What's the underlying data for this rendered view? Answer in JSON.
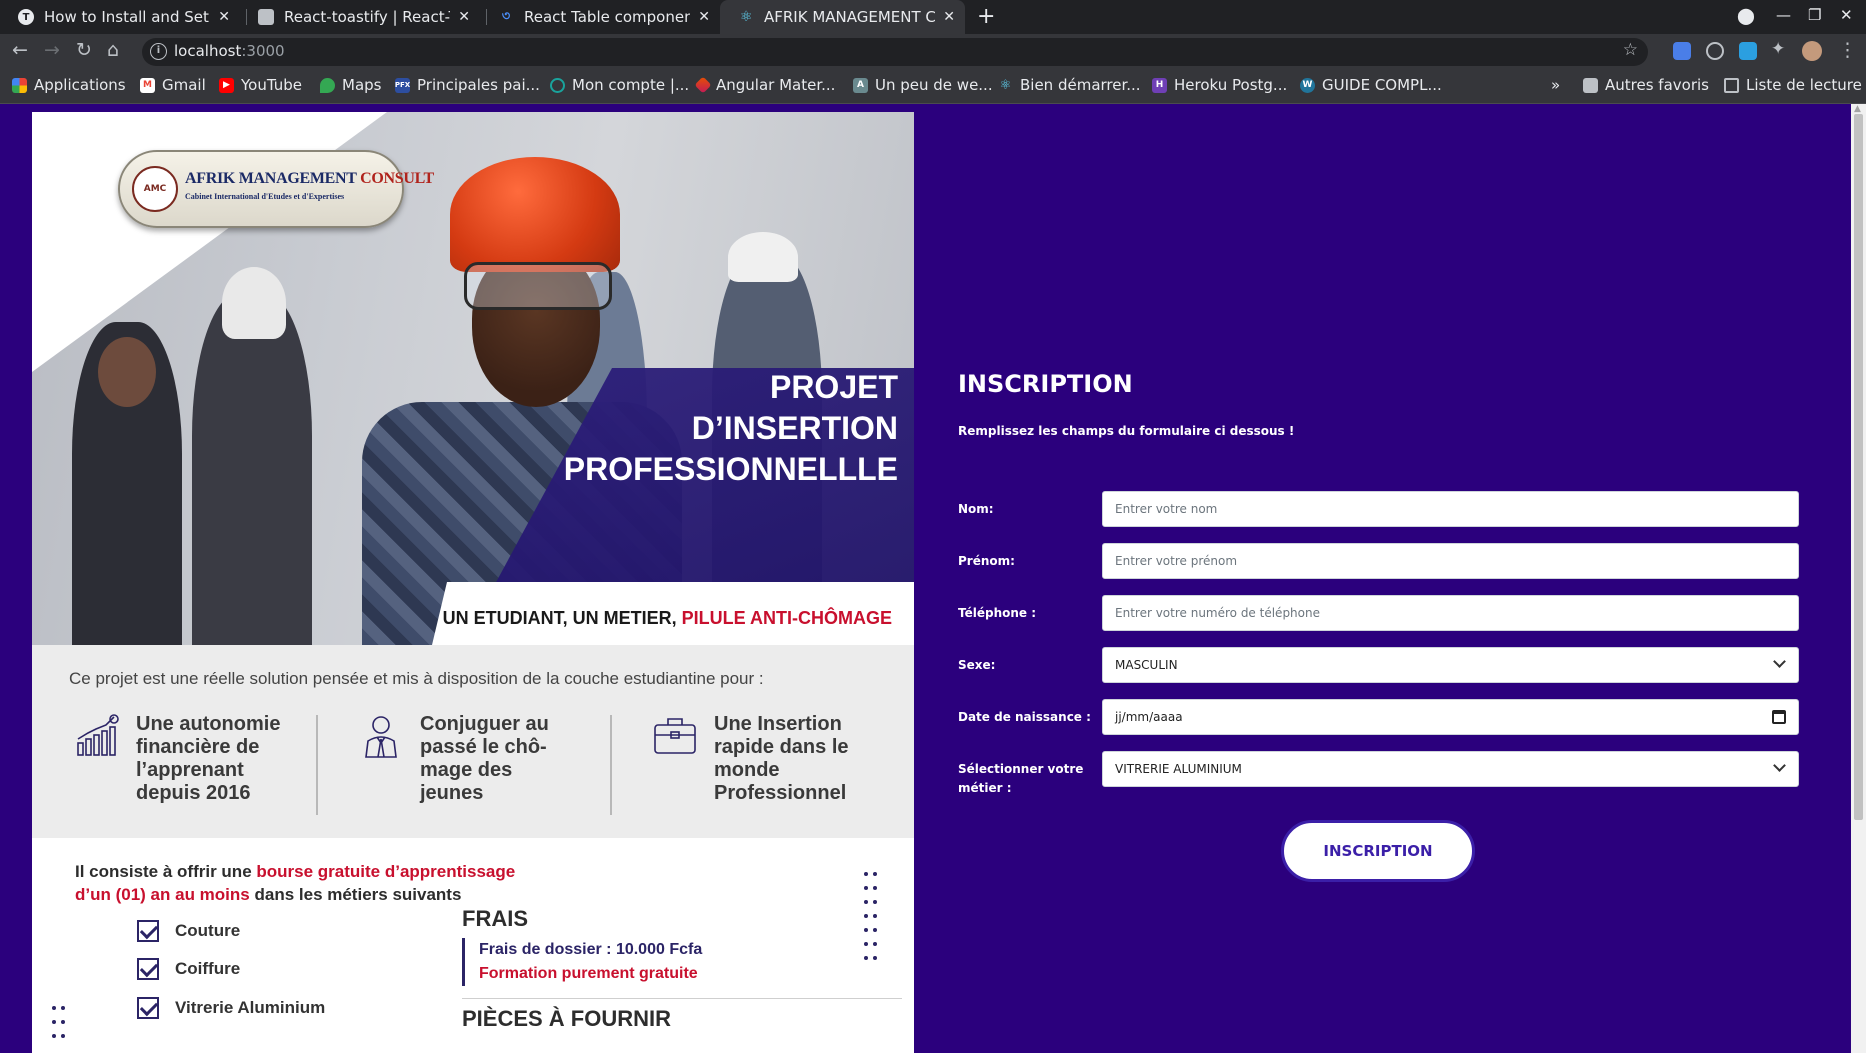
{
  "browser": {
    "tabs": [
      {
        "title": "How to Install and Setup",
        "favicon": "T"
      },
      {
        "title": "React-toastify | React-Toa",
        "favicon": ""
      },
      {
        "title": "React Table component - I",
        "favicon": ""
      },
      {
        "title": "AFRIK MANAGEMENT CO",
        "favicon": ""
      }
    ],
    "url_host": "localhost",
    "url_port": ":3000",
    "bookmarks": [
      {
        "label": "Applications",
        "icon": "apps-grid-icon",
        "color": "#e94235"
      },
      {
        "label": "Gmail",
        "icon": "gmail-icon",
        "color": "#ea4335"
      },
      {
        "label": "YouTube",
        "icon": "youtube-icon",
        "color": "#ff0000"
      },
      {
        "label": "Maps",
        "icon": "maps-icon",
        "color": "#34a853"
      },
      {
        "label": "Principales pai...",
        "icon": "pfx-icon",
        "color": "#2d4ea0"
      },
      {
        "label": "Mon compte |...",
        "icon": "account-icon",
        "color": "#1aa39c"
      },
      {
        "label": "Angular Mater...",
        "icon": "angular-material-icon",
        "color": "#e65100"
      },
      {
        "label": "Un peu de we...",
        "icon": "web-icon",
        "color": "#6a8a8f"
      },
      {
        "label": "Bien démarrer...",
        "icon": "react-icon",
        "color": "#61dafb"
      },
      {
        "label": "Heroku Postg...",
        "icon": "heroku-icon",
        "color": "#6f3fb5"
      },
      {
        "label": "GUIDE COMPL...",
        "icon": "wordpress-icon",
        "color": "#21759b"
      }
    ],
    "bookmarks_more": "»",
    "other_favorites": "Autres favoris",
    "reading_list": "Liste de lecture"
  },
  "flyer": {
    "logo_line1_a": "AFRIK MANAGEMENT",
    "logo_line1_b": "CONSULT",
    "logo_line2": "Cabinet International d'Etudes et d'Expertises",
    "logo_seal": "AMC",
    "title_line1": "PROJET",
    "title_line2": "D’INSERTION",
    "title_line3": "PROFESSIONNELLLE",
    "slogan_a": "UN ETUDIANT, UN METIER,",
    "slogan_b": "PILULE ANTI-CHÔMAGE",
    "intro": "Ce projet est une réelle solution pensée et mis à disposition de la couche estudiantine pour :",
    "benefits": [
      {
        "icon": "growth-chart-icon",
        "lines": [
          "Une autonomie",
          "financière de",
          "l’apprenant",
          "depuis 2016"
        ]
      },
      {
        "icon": "businessman-icon",
        "lines": [
          "Conjuguer au",
          "passé le chô-",
          "mage des",
          "jeunes"
        ]
      },
      {
        "icon": "briefcase-icon",
        "lines": [
          "Une Insertion",
          "rapide dans le",
          "monde",
          "Professionnel"
        ]
      }
    ],
    "consiste_a": "Il consiste à offrir une",
    "consiste_b": "bourse gratuite d’apprentissage",
    "consiste_c": "d’un (01) an au moins",
    "consiste_d": "dans les métiers suivants",
    "metiers": [
      "Couture",
      "Coiffure",
      "Vitrerie Aluminium"
    ],
    "frais_title": "FRAIS",
    "frais_line1": "Frais de dossier : 10.000 Fcfa",
    "frais_line2": "Formation purement gratuite",
    "pieces_title": "PIÈCES À FOURNIR",
    "colors": {
      "navy": "#2b2466",
      "red": "#c8102e"
    }
  },
  "form": {
    "title": "INSCRIPTION",
    "subtitle": "Remplissez les champs du formulaire ci dessous !",
    "fields": {
      "nom": {
        "label": "Nom:",
        "placeholder": "Entrer votre nom"
      },
      "prenom": {
        "label": "Prénom:",
        "placeholder": "Entrer votre prénom"
      },
      "telephone": {
        "label": "Téléphone :",
        "placeholder": "Entrer votre numéro de téléphone"
      },
      "sexe": {
        "label": "Sexe:",
        "value": "MASCULIN"
      },
      "naissance": {
        "label": "Date de naissance :",
        "placeholder": "jj/mm/aaaa"
      },
      "metier": {
        "label_line1": "Sélectionner votre",
        "label_line2": "métier :",
        "value": "VITRERIE ALUMINIUM"
      }
    },
    "submit_label": "INSCRIPTION",
    "colors": {
      "background": "#2b007d",
      "button_text": "#3b1fa8"
    }
  }
}
